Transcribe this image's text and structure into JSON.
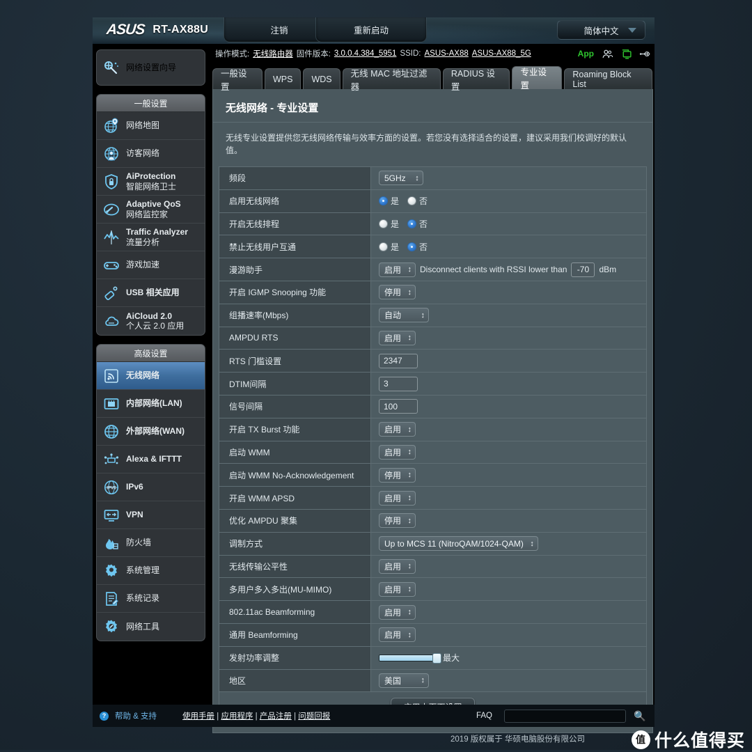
{
  "topbar": {
    "brand": "ASUS",
    "model": "RT-AX88U",
    "logout_label": "注销",
    "reboot_label": "重新启动",
    "language": "简体中文"
  },
  "info": {
    "mode_label": "操作模式:",
    "mode_value": "无线路由器",
    "firmware_label": "固件版本:",
    "firmware_value": "3.0.0.4.384_5951",
    "ssid_label": "SSID:",
    "ssid_24": "ASUS-AX88",
    "ssid_5g": "ASUS-AX88_5G",
    "app_label": "App"
  },
  "sidebar": {
    "wizard": {
      "label": "网络设置向导",
      "icon": "wizard-icon"
    },
    "general_header": "一般设置",
    "general_items": [
      {
        "line1": "网络地图",
        "line2": "",
        "icon": "network-map-icon",
        "bold": false
      },
      {
        "line1": "访客网络",
        "line2": "",
        "icon": "guest-network-icon",
        "bold": false
      },
      {
        "line1": "AiProtection",
        "line2": "智能网络卫士",
        "icon": "shield-icon",
        "bold": true
      },
      {
        "line1": "Adaptive QoS",
        "line2": "网络监控家",
        "icon": "gauge-icon",
        "bold": true
      },
      {
        "line1": "Traffic Analyzer",
        "line2": "流量分析",
        "icon": "traffic-analyzer-icon",
        "bold": true
      },
      {
        "line1": "游戏加速",
        "line2": "",
        "icon": "gamepad-icon",
        "bold": false
      },
      {
        "line1": "USB 相关应用",
        "line2": "",
        "icon": "usb-icon",
        "bold": true
      },
      {
        "line1": "AiCloud 2.0",
        "line2": "个人云 2.0 应用",
        "icon": "cloud-icon",
        "bold": true
      }
    ],
    "advanced_header": "高级设置",
    "advanced_items": [
      {
        "line1": "无线网络",
        "line2": "",
        "icon": "wifi-icon",
        "bold": false,
        "selected": true
      },
      {
        "line1": "内部网络(LAN)",
        "line2": "",
        "icon": "lan-icon",
        "bold": true,
        "selected": false
      },
      {
        "line1": "外部网络(WAN)",
        "line2": "",
        "icon": "wan-icon",
        "bold": true,
        "selected": false
      },
      {
        "line1": "Alexa & IFTTT",
        "line2": "",
        "icon": "alexa-ifttt-icon",
        "bold": true,
        "selected": false
      },
      {
        "line1": "IPv6",
        "line2": "",
        "icon": "ipv6-icon",
        "bold": true,
        "selected": false
      },
      {
        "line1": "VPN",
        "line2": "",
        "icon": "vpn-icon",
        "bold": true,
        "selected": false
      },
      {
        "line1": "防火墙",
        "line2": "",
        "icon": "firewall-icon",
        "bold": false,
        "selected": false
      },
      {
        "line1": "系统管理",
        "line2": "",
        "icon": "admin-icon",
        "bold": false,
        "selected": false
      },
      {
        "line1": "系统记录",
        "line2": "",
        "icon": "syslog-icon",
        "bold": false,
        "selected": false
      },
      {
        "line1": "网络工具",
        "line2": "",
        "icon": "network-tools-icon",
        "bold": false,
        "selected": false
      }
    ]
  },
  "tabs": [
    {
      "label": "一般设置",
      "active": false
    },
    {
      "label": "WPS",
      "active": false
    },
    {
      "label": "WDS",
      "active": false
    },
    {
      "label": "无线 MAC 地址过滤器",
      "active": false
    },
    {
      "label": "RADIUS 设置",
      "active": false
    },
    {
      "label": "专业设置",
      "active": true
    },
    {
      "label": "Roaming Block List",
      "active": false
    }
  ],
  "panel": {
    "title": "无线网络 - 专业设置",
    "description": "无线专业设置提供您无线网络传输与效率方面的设置。若您没有选择适合的设置，建议采用我们校调好的默认值。",
    "apply_label": "应用本页面设置"
  },
  "settings": {
    "band": {
      "label": "频段",
      "value": "5GHz"
    },
    "enable_wireless": {
      "label": "启用无线网络",
      "yes": "是",
      "no": "否",
      "selected": "yes"
    },
    "enable_schedule": {
      "label": "开启无线排程",
      "yes": "是",
      "no": "否",
      "selected": "no"
    },
    "block_intra": {
      "label": "禁止无线用户互通",
      "yes": "是",
      "no": "否",
      "selected": "no"
    },
    "roaming": {
      "label": "漫游助手",
      "value": "启用",
      "text": "Disconnect clients with RSSI lower than",
      "rssi": "-70",
      "unit": "dBm"
    },
    "igmp_snooping": {
      "label": "开启 IGMP Snooping 功能",
      "value": "停用"
    },
    "multicast_rate": {
      "label": "组播速率(Mbps)",
      "value": "自动"
    },
    "ampdu_rts": {
      "label": "AMPDU RTS",
      "value": "启用"
    },
    "rts_threshold": {
      "label": "RTS 门槛设置",
      "value": "2347"
    },
    "dtim": {
      "label": "DTIM间隔",
      "value": "3"
    },
    "beacon": {
      "label": "信号间隔",
      "value": "100"
    },
    "tx_burst": {
      "label": "开启 TX Burst 功能",
      "value": "启用"
    },
    "wmm": {
      "label": "启动 WMM",
      "value": "启用"
    },
    "wmm_noack": {
      "label": "启动 WMM No-Acknowledgement",
      "value": "停用"
    },
    "wmm_apsd": {
      "label": "开启 WMM APSD",
      "value": "启用"
    },
    "ampdu_opt": {
      "label": "优化 AMPDU 聚集",
      "value": "停用"
    },
    "modulation": {
      "label": "调制方式",
      "value": "Up to MCS 11 (NitroQAM/1024-QAM)"
    },
    "airtime_fairness": {
      "label": "无线传输公平性",
      "value": "启用"
    },
    "mumimo": {
      "label": "多用户多入多出(MU-MIMO)",
      "value": "启用"
    },
    "beamforming_ac": {
      "label": "802.11ac Beamforming",
      "value": "启用"
    },
    "beamforming_univ": {
      "label": "通用 Beamforming",
      "value": "启用"
    },
    "tx_power": {
      "label": "发射功率调整",
      "value": "最大"
    },
    "region": {
      "label": "地区",
      "value": "美国"
    }
  },
  "footer": {
    "help_label": "帮助 & 支持",
    "manual": "使用手册",
    "apps": "应用程序",
    "register": "产品注册",
    "feedback": "问题回报",
    "sep": "|",
    "faq": "FAQ",
    "copyright": "2019 版权属于 华硕电脑股份有限公司",
    "watermark": "什么值得买",
    "watermark_badge": "值"
  },
  "colors": {
    "accent_blue": "#4a8ed0",
    "panel_bg": "#4a585e",
    "label_bg": "#3c474c",
    "value_bg": "#4d5c62",
    "app_green": "#2fc52f",
    "page_bg": "#1d2a35"
  }
}
